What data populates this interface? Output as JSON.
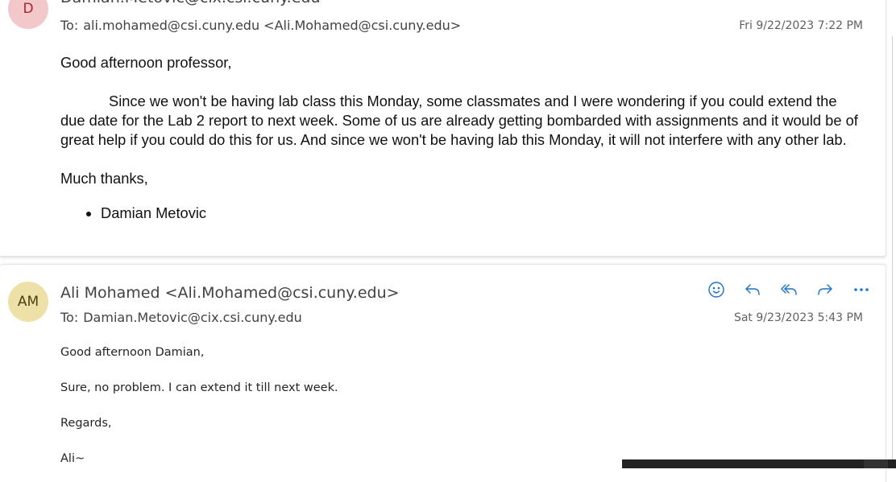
{
  "message1": {
    "avatar_initial": "D",
    "sender": "Damian.Metovic@cix.csi.cuny.edu",
    "to_label": "To:",
    "to_value": "ali.mohamed@csi.cuny.edu <Ali.Mohamed@csi.cuny.edu>",
    "date": "Fri 9/22/2023 7:22 PM",
    "greeting": "Good afternoon professor,",
    "paragraph": "Since we won't be having lab class this Monday, some classmates and I were wondering if you could extend the due date for the Lab 2 report to next week. Some of us are already getting bombarded with assignments and it would be of great help if you could do this for us. And since we won't be having lab this Monday, it will not interfere with any other lab.",
    "closing": "Much thanks,",
    "signature_bullet": "Damian Metovic"
  },
  "message2": {
    "avatar_initials": "AM",
    "sender": "Ali Mohamed <Ali.Mohamed@csi.cuny.edu>",
    "to_label": "To:",
    "to_value": "Damian.Metovic@cix.csi.cuny.edu",
    "date": "Sat 9/23/2023 5:43 PM",
    "line1": "Good afternoon Damian,",
    "line2": "Sure, no problem. I can extend it till next week.",
    "line3": "Regards,",
    "line4": "Ali~"
  },
  "actions": [
    {
      "name": "emoji-react-icon"
    },
    {
      "name": "reply-icon"
    },
    {
      "name": "reply-all-icon"
    },
    {
      "name": "forward-icon"
    },
    {
      "name": "more-options-icon"
    }
  ],
  "colors": {
    "accent": "#1a73c8",
    "avatar_d_bg": "#f3c8cb",
    "avatar_am_bg": "#ede1a7"
  }
}
